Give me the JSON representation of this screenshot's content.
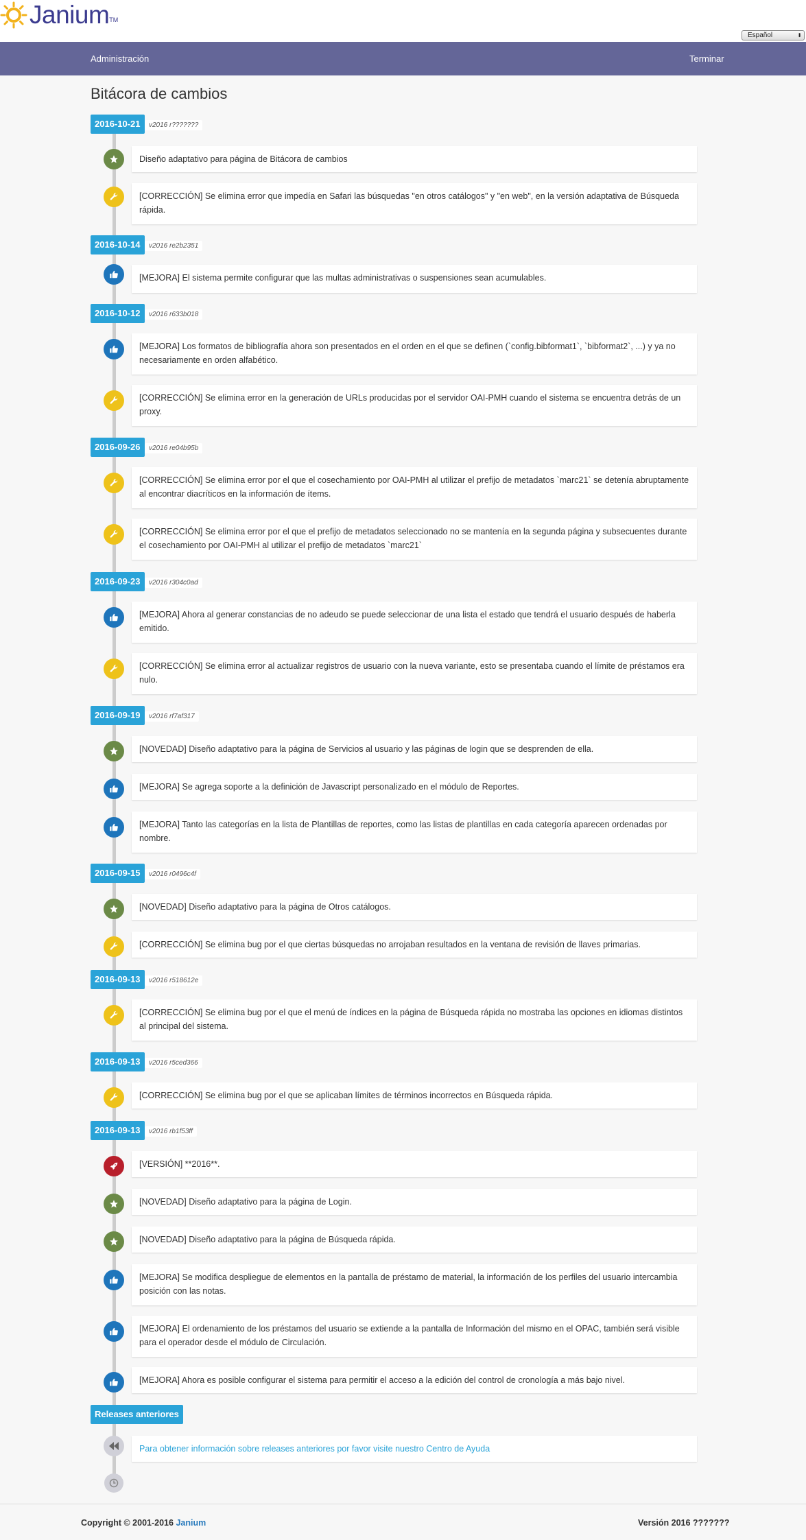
{
  "header": {
    "logo_text": "Janium",
    "logo_tm": "TM",
    "language_select": "Español"
  },
  "nav": {
    "admin": "Administración",
    "logout": "Terminar"
  },
  "page": {
    "title": "Bitácora de cambios"
  },
  "releases": [
    {
      "date": "2016-10-21",
      "rev": "v2016 r???????",
      "items": [
        {
          "type": "star",
          "text": "Diseño adaptativo para página de Bitácora de cambios"
        },
        {
          "type": "wrench",
          "text": "[CORRECCIÓN] Se elimina error que impedía en Safari las búsquedas \"en otros catálogos\" y \"en web\", en la versión adaptativa de Búsqueda rápida."
        }
      ]
    },
    {
      "date": "2016-10-14",
      "rev": "v2016 re2b2351",
      "items": [
        {
          "type": "thumb",
          "text": "[MEJORA] El sistema permite configurar que las multas administrativas o suspensiones sean acumulables."
        }
      ]
    },
    {
      "date": "2016-10-12",
      "rev": "v2016 r633b018",
      "items": [
        {
          "type": "thumb",
          "text": "[MEJORA] Los formatos de bibliografía ahora son presentados en el orden en el que se definen (`config.bibformat1`, `bibformat2`, ...) y ya no necesariamente en orden alfabético."
        },
        {
          "type": "wrench",
          "text": "[CORRECCIÓN] Se elimina error en la generación de URLs producidas por el servidor OAI-PMH cuando el sistema se encuentra detrás de un proxy."
        }
      ]
    },
    {
      "date": "2016-09-26",
      "rev": "v2016 re04b95b",
      "items": [
        {
          "type": "wrench",
          "text": "[CORRECCIÓN] Se elimina error por el que el cosechamiento por OAI-PMH al utilizar el prefijo de metadatos `marc21` se detenía abruptamente al encontrar diacríticos en la información de ítems."
        },
        {
          "type": "wrench",
          "text": "[CORRECCIÓN] Se elimina error por el que el prefijo de metadatos seleccionado no se mantenía en la segunda página y subsecuentes durante el cosechamiento por OAI-PMH al utilizar el prefijo de metadatos `marc21`"
        }
      ]
    },
    {
      "date": "2016-09-23",
      "rev": "v2016 r304c0ad",
      "items": [
        {
          "type": "thumb",
          "text": "[MEJORA] Ahora al generar constancias de no adeudo se puede seleccionar de una lista el estado que tendrá el usuario después de haberla emitido."
        },
        {
          "type": "wrench",
          "text": "[CORRECCIÓN] Se elimina error al actualizar registros de usuario con la nueva variante, esto se presentaba cuando el límite de préstamos era nulo."
        }
      ]
    },
    {
      "date": "2016-09-19",
      "rev": "v2016 rf7af317",
      "items": [
        {
          "type": "star",
          "text": "[NOVEDAD] Diseño adaptativo para la página de Servicios al usuario y las páginas de login que se desprenden de ella."
        },
        {
          "type": "thumb",
          "text": "[MEJORA] Se agrega soporte a la definición de Javascript personalizado en el módulo de Reportes."
        },
        {
          "type": "thumb",
          "text": "[MEJORA] Tanto las categorías en la lista de Plantillas de reportes, como las listas de plantillas en cada categoría aparecen ordenadas por nombre."
        }
      ]
    },
    {
      "date": "2016-09-15",
      "rev": "v2016 r0496c4f",
      "items": [
        {
          "type": "star",
          "text": "[NOVEDAD] Diseño adaptativo para la página de Otros catálogos."
        },
        {
          "type": "wrench",
          "text": "[CORRECCIÓN] Se elimina bug por el que ciertas búsquedas no arrojaban resultados en la ventana de revisión de llaves primarias."
        }
      ]
    },
    {
      "date": "2016-09-13",
      "rev": "v2016 r518612e",
      "items": [
        {
          "type": "wrench",
          "text": "[CORRECCIÓN] Se elimina bug por el que el menú de índices en la página de Búsqueda rápida no mostraba las opciones en idiomas distintos al principal del sistema."
        }
      ]
    },
    {
      "date": "2016-09-13",
      "rev": "v2016 r5ced366",
      "items": [
        {
          "type": "wrench",
          "text": "[CORRECCIÓN] Se elimina bug por el que se aplicaban límites de términos incorrectos en Búsqueda rápida."
        }
      ]
    },
    {
      "date": "2016-09-13",
      "rev": "v2016 rb1f53ff",
      "items": [
        {
          "type": "rocket",
          "text": "[VERSIÓN] **2016**."
        },
        {
          "type": "star",
          "text": "[NOVEDAD] Diseño adaptativo para la página de Login."
        },
        {
          "type": "star",
          "text": "[NOVEDAD] Diseño adaptativo para la página de Búsqueda rápida."
        },
        {
          "type": "thumb",
          "text": "[MEJORA] Se modifica despliegue de elementos en la pantalla de préstamo de material, la información de los perfiles del usuario intercambia posición con las notas."
        },
        {
          "type": "thumb",
          "text": "[MEJORA] El ordenamiento de los préstamos del usuario se extiende a la pantalla de Información del mismo en el OPAC, también será visible para el operador desde el módulo de Circulación."
        },
        {
          "type": "thumb",
          "text": "[MEJORA] Ahora es posible configurar el sistema para permitir el acceso a la edición del control de cronología a más bajo nivel."
        }
      ]
    }
  ],
  "older": {
    "label": "Releases anteriores",
    "link_text": "Para obtener información sobre releases anteriores por favor visite nuestro Centro de Ayuda"
  },
  "footer": {
    "copyright_prefix": "Copyright © 2001-2016",
    "brand": "Janium",
    "version": "Versión 2016 ???????"
  }
}
